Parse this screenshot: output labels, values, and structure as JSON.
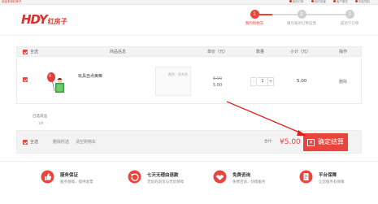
{
  "topbar": {
    "welcome": "欢迎来到红房子",
    "links": [
      "我的订单",
      "我的收藏",
      "客户服务",
      "网站导航"
    ]
  },
  "logo": {
    "mark": "HDY",
    "name": "红房子"
  },
  "steps": [
    {
      "num": "1",
      "label": "我的购物车",
      "active": true
    },
    {
      "num": "2",
      "label": "填写核对订单信息",
      "active": false
    },
    {
      "num": "3",
      "label": "成功下订单",
      "active": false
    }
  ],
  "table": {
    "select_all": "全选",
    "headers": {
      "product": "商品信息",
      "unit_price": "单价（元）",
      "quantity": "数量",
      "subtotal": "小计（元）",
      "action": "操作"
    }
  },
  "items": [
    {
      "name": "玩具自点美嘛",
      "attr": "颜色：积木积",
      "price_old": "6.00",
      "price_now": "5.00",
      "quantity": "1",
      "subtotal": "5.00",
      "delete": "删除"
    }
  ],
  "selected": {
    "label": "已选商品",
    "count": "1件"
  },
  "footer": {
    "select_all": "全选",
    "delete_selected": "删除所选",
    "clear_cart": "清空购物车",
    "total_label": "合计:",
    "total_value": "¥5.00",
    "checkout_label": "确定结算",
    "checkout_icon": "¥"
  },
  "guarantees": [
    {
      "title": "服务保证",
      "desc": "服务保障，提供发票",
      "icon": "thumbs-up-icon"
    },
    {
      "title": "七天无理由退款",
      "desc": "无忧的退货与无忧保障",
      "icon": "return-icon"
    },
    {
      "title": "免费咨询",
      "desc": "免费咨询，热情服务",
      "icon": "handshake-icon"
    },
    {
      "title": "平台保障",
      "desc": "让您服务有保障",
      "icon": "document-icon"
    }
  ],
  "colors": {
    "accent": "#e8453c",
    "brand": "#d8322c"
  }
}
